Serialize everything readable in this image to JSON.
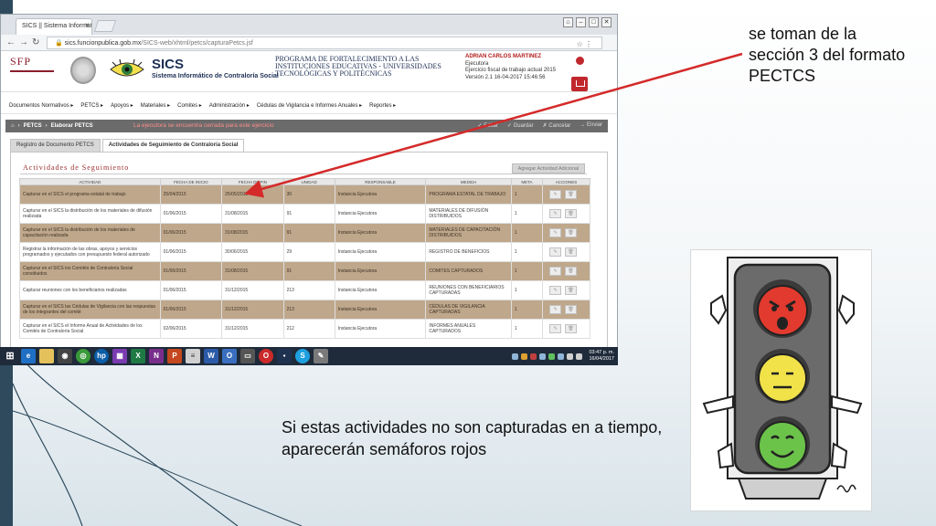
{
  "browser": {
    "tab_title": "SICS || Sistema Informati",
    "tab_close": "×",
    "url_domain": "sics.funcionpublica.gob.mx",
    "url_path": "/SICS-web/xhtml/petcs/capturaPetcs.jsf"
  },
  "header": {
    "sfp_logo": "SFP",
    "sics_logo": "SICS",
    "sics_subtitle": "Sistema Informático de Contraloría Social",
    "program_title": "PROGRAMA DE FORTALECIMIENTO A LAS INSTITUCIONES EDUCATIVAS - UNIVERSIDADES TECNOLÓGICAS Y POLITÉCNICAS",
    "user_name": "ADRIAN CARLOS MARTINEZ",
    "user_role": "Ejecutora",
    "fiscal_year": "Ejercicio fiscal de trabajo actual  2015",
    "version": "Versión 2.1   16-04-2017 15:46:56"
  },
  "menu": [
    "Documentos Normativos ▸",
    "PETCS ▸",
    "Apoyos ▸",
    "Materiales ▸",
    "Comites ▸",
    "Administración ▸",
    "Cédulas de Vigilancia e Informes Anuales ▸",
    "Reportes ▸"
  ],
  "breadcrumb": {
    "home": "⌂",
    "item1": "PETCS",
    "item2": "Elaborar PETCS",
    "message": "La ejecutora se encuentra cerrada para este ejercicio",
    "actions": [
      "✓ Editar",
      "✓ Guardar",
      "✗ Cancelar",
      "→ Enviar"
    ]
  },
  "tabs": [
    "Registro de Documento PETCS",
    "Actividades de Seguimiento de Contraloría Social"
  ],
  "section": {
    "title": "Actividades de Seguimiento",
    "add_button": "Agregar Actividad Adicional"
  },
  "table": {
    "headers": [
      "Actividad",
      "Fecha de Inicio",
      "Fecha de Fin",
      "Unidad",
      "Responsable",
      "Medida",
      "Meta",
      "Acciones"
    ],
    "rows": [
      {
        "actividad": "Capturar en el SICS el programa estatal de trabajo",
        "inicio": "25/04/2015",
        "fin": "25/05/2015",
        "unidad": "30",
        "responsable": "Instancia Ejecutora",
        "medida": "PROGRAMA ESTATAL DE TRABAJO",
        "meta": "1"
      },
      {
        "actividad": "Capturar en el SICS la distribución de los materiales de difusión realizada",
        "inicio": "01/06/2015",
        "fin": "31/08/2015",
        "unidad": "91",
        "responsable": "Instancia Ejecutora",
        "medida": "MATERIALES DE DIFUSIÓN DISTRIBUIDOS",
        "meta": "1"
      },
      {
        "actividad": "Capturar en el SICS la distribución de los materiales de capacitación realizada",
        "inicio": "01/06/2015",
        "fin": "31/08/2015",
        "unidad": "91",
        "responsable": "Instancia Ejecutora",
        "medida": "MATERIALES DE CAPACITACIÓN DISTRIBUIDOS",
        "meta": "1"
      },
      {
        "actividad": "Registrar la información de las obras, apoyos y servicios programados y ejecutados con presupuesto federal autorizado",
        "inicio": "01/06/2015",
        "fin": "30/06/2015",
        "unidad": "29",
        "responsable": "Instancia Ejecutora",
        "medida": "REGISTRO DE BENEFICIOS",
        "meta": "1"
      },
      {
        "actividad": "Capturar en el SICS los Comités de Contraloría Social constituidos",
        "inicio": "01/06/2015",
        "fin": "31/08/2015",
        "unidad": "91",
        "responsable": "Instancia Ejecutora",
        "medida": "COMITES CAPTURADOS",
        "meta": "1"
      },
      {
        "actividad": "Capturar reuniones con los beneficiarios realizadas",
        "inicio": "01/06/2015",
        "fin": "31/12/2015",
        "unidad": "213",
        "responsable": "Instancia Ejecutora",
        "medida": "REUNIONES CON BENEFICIARIOS CAPTURADAS",
        "meta": "1"
      },
      {
        "actividad": "Capturar en el SICS las Cédulas de Vigilancia con las respuestas de los integrantes del comité",
        "inicio": "01/06/2015",
        "fin": "31/12/2015",
        "unidad": "213",
        "responsable": "Instancia Ejecutora",
        "medida": "CÉDULAS DE VIGILANCIA CAPTURADAS",
        "meta": "1"
      },
      {
        "actividad": "Capturar en el SICS el Informe Anual de Actividades de los Comités de Contraloría Social",
        "inicio": "02/06/2015",
        "fin": "31/12/2015",
        "unidad": "212",
        "responsable": "Instancia Ejecutora",
        "medida": "INFORMES ANUALES CAPTURADOS",
        "meta": "1"
      }
    ]
  },
  "taskbar": {
    "clock_time": "03:47 p. m.",
    "clock_date": "16/04/2017"
  },
  "annotations": {
    "note_top": "se toman de la sección 3 del formato PECTCS",
    "note_bottom": "Si estas actividades no son capturadas en a tiempo, aparecerán semáforos rojos"
  },
  "colors": {
    "alt_row": "#bfa78b",
    "arrow": "#d42a2a",
    "stripe": "#2e4a5c"
  }
}
